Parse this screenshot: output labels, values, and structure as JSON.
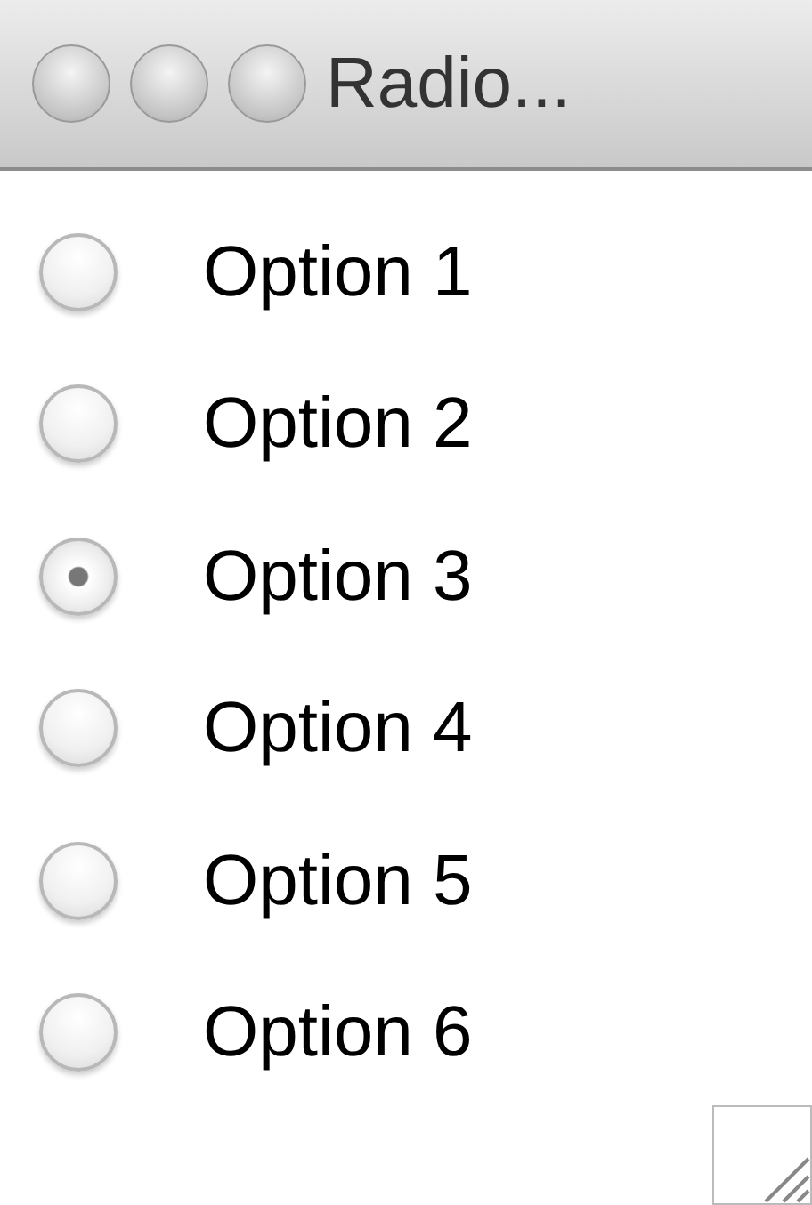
{
  "window": {
    "title": "Radio..."
  },
  "options": [
    {
      "label": "Option 1",
      "selected": false
    },
    {
      "label": "Option 2",
      "selected": false
    },
    {
      "label": "Option 3",
      "selected": true
    },
    {
      "label": "Option 4",
      "selected": false
    },
    {
      "label": "Option 5",
      "selected": false
    },
    {
      "label": "Option 6",
      "selected": false
    }
  ]
}
